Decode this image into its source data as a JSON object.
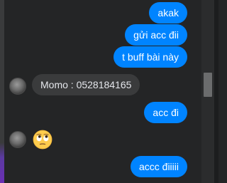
{
  "messages": [
    {
      "side": "out",
      "text": "akak"
    },
    {
      "side": "out",
      "text": "gửi acc đii"
    },
    {
      "side": "out",
      "text": "t buff bài này"
    },
    {
      "side": "in",
      "text": "Momo : 0528184165"
    },
    {
      "side": "out",
      "text": "acc đi"
    },
    {
      "side": "in",
      "emoji": "face-with-rolling-eyes-emoji"
    },
    {
      "side": "out",
      "text": "accc điiiii"
    }
  ],
  "colors": {
    "background": "#242526",
    "outgoing_bubble": "#0084ff",
    "incoming_bubble": "#3a3b3c",
    "outgoing_text": "#ffffff",
    "incoming_text": "#e4e6eb",
    "scrollbar_thumb": "#6b6c6d"
  }
}
